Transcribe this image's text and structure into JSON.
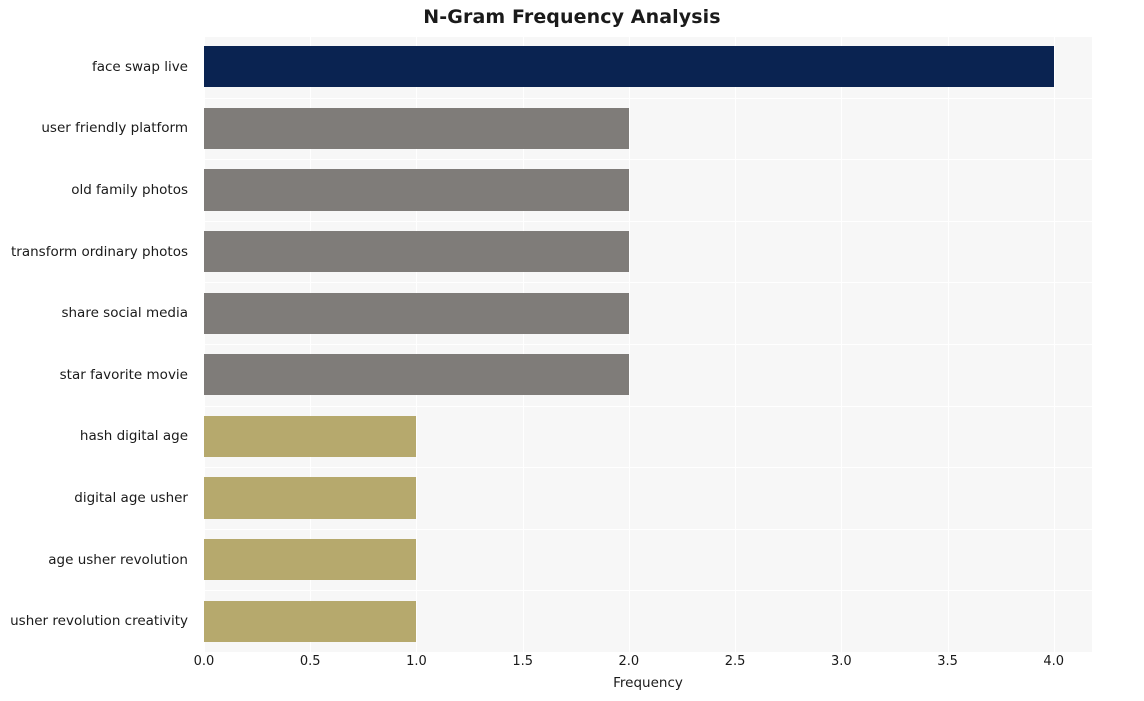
{
  "chart_data": {
    "type": "bar",
    "orientation": "horizontal",
    "title": "N-Gram Frequency Analysis",
    "xlabel": "Frequency",
    "ylabel": "",
    "categories": [
      "face swap live",
      "user friendly platform",
      "old family photos",
      "transform ordinary photos",
      "share social media",
      "star favorite movie",
      "hash digital age",
      "digital age usher",
      "age usher revolution",
      "usher revolution creativity"
    ],
    "values": [
      4,
      2,
      2,
      2,
      2,
      2,
      1,
      1,
      1,
      1
    ],
    "bar_colors": [
      "#0a2351",
      "#7f7c79",
      "#7f7c79",
      "#7f7c79",
      "#7f7c79",
      "#7f7c79",
      "#b6a96d",
      "#b6a96d",
      "#b6a96d",
      "#b6a96d"
    ],
    "xlim": [
      0,
      4.18
    ],
    "xticks": [
      0.0,
      0.5,
      1.0,
      1.5,
      2.0,
      2.5,
      3.0,
      3.5,
      4.0
    ],
    "xticklabels": [
      "0.0",
      "0.5",
      "1.0",
      "1.5",
      "2.0",
      "2.5",
      "3.0",
      "3.5",
      "4.0"
    ],
    "grid": true,
    "grid_color": "#ffffff",
    "plot_background": "#f7f7f7",
    "figure_background": "#ffffff",
    "legend": null
  }
}
